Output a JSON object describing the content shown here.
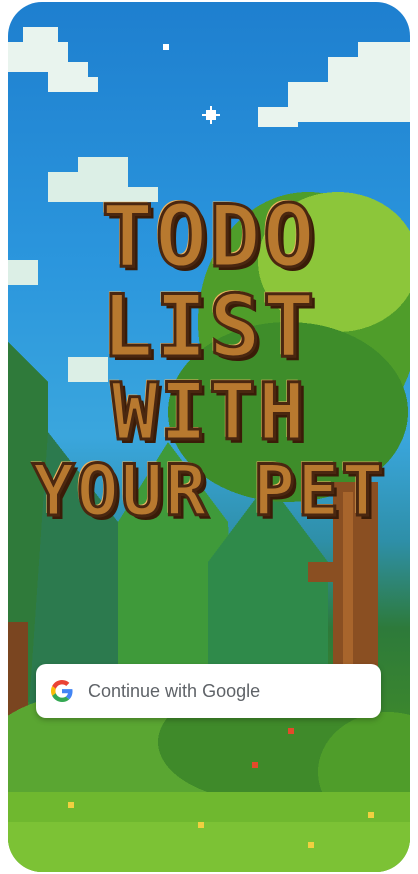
{
  "title": {
    "line1": "TODO",
    "line2": "LIST",
    "line3": "WITH",
    "line4": "YOUR PET"
  },
  "auth": {
    "google_button_label": "Continue with Google",
    "google_icon": "google-g-icon"
  },
  "colors": {
    "sky": "#2b96dd",
    "foliage": "#3f8a2a",
    "title_fill": "#b8792f",
    "title_outline": "#4a2710"
  }
}
